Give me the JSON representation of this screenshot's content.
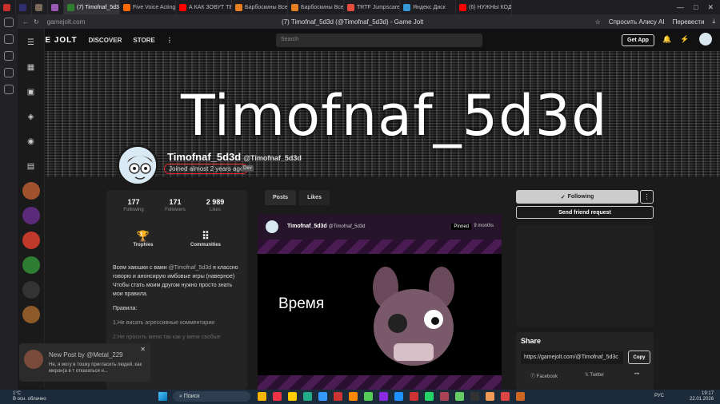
{
  "browser": {
    "tabs": [
      {
        "label": "",
        "color": "#c9302c"
      },
      {
        "label": "",
        "color": "#2f2f6f"
      },
      {
        "label": "",
        "color": "#7a6a5a"
      },
      {
        "label": "",
        "color": "#9b59b6"
      },
      {
        "label": "(7) Timofnaf_5d3d (@Timo",
        "color": "#2f7f2f",
        "active": true
      },
      {
        "label": "Five Voice Acting",
        "color": "#ff6a00"
      },
      {
        "label": "А КАК ЗОВУТ ТЕ",
        "color": "#ff0000"
      },
      {
        "label": "Барбоскины Все",
        "color": "#e67e22"
      },
      {
        "label": "Барбоскины Все",
        "color": "#e67e22"
      },
      {
        "label": "TRTF Jumpscare",
        "color": "#e74c3c"
      },
      {
        "label": "Яндекс Диск",
        "color": "#3498db"
      },
      {
        "label": "(6) НУЖНЫ КОД",
        "color": "#ff0000"
      }
    ],
    "url": "gamejolt.com",
    "page_title": "(7) Timofnaf_5d3d (@Timofnaf_5d3d) - Game Jolt",
    "alice_label": "Спросить Алису AI",
    "translate_label": "Перевести"
  },
  "nav": {
    "logo": "GAME JOLT",
    "discover": "DISCOVER",
    "store": "STORE",
    "search_placeholder": "Search",
    "get_app": "Get App"
  },
  "profile": {
    "banner_text": "Timofnaf_5d3d",
    "name": "Timofnaf_5d3d",
    "handle": "@Timofnaf_5d3d",
    "joined": "Joined almost 2 years ago",
    "badge": "Dev",
    "stats": [
      {
        "value": "177",
        "label": "Following"
      },
      {
        "value": "171",
        "label": "Followers"
      },
      {
        "value": "2 989",
        "label": "Likes"
      }
    ],
    "trophies": "Trophies",
    "communities": "Communities",
    "bio_1a": "Всем хаюшки с вами ",
    "bio_mention": "@Timofnaf_5d3d",
    "bio_1b": " я классно говорю и анонсирую имбовые игры (наверное) Чтобы стать моим другом нужно просто знать мои правила.",
    "bio_rules": "Правила:",
    "bio_rule1": "1.Не висать агрессивные комментарии",
    "bio_rule2": "2.Не просить меня так как у меня свобые"
  },
  "feed": {
    "tab_posts": "Posts",
    "tab_likes": "Likes",
    "post_author": "Timofnaf_5d3d",
    "post_handle": "@Timofnaf_5d3d",
    "pinned": "Pinned",
    "post_time": "9 months",
    "post_text": "Время"
  },
  "side": {
    "following": "Following",
    "send_request": "Send friend request",
    "share_title": "Share",
    "share_link": "https://gamejolt.com/@Timofnaf_5d3c",
    "copy": "Copy",
    "facebook": "Facebook",
    "twitter": "Twitter",
    "more": "•••"
  },
  "notification": {
    "title": "New Post by @Metal_229",
    "body": "Не, я могу в тошку пригласить людей, как мирон(а в т отказаться н..."
  },
  "taskbar": {
    "temp": "1°C",
    "weather": "В осн. облачно",
    "search": "Поиск",
    "lang": "РУС",
    "time": "19:17",
    "date": "22.01.2026"
  }
}
